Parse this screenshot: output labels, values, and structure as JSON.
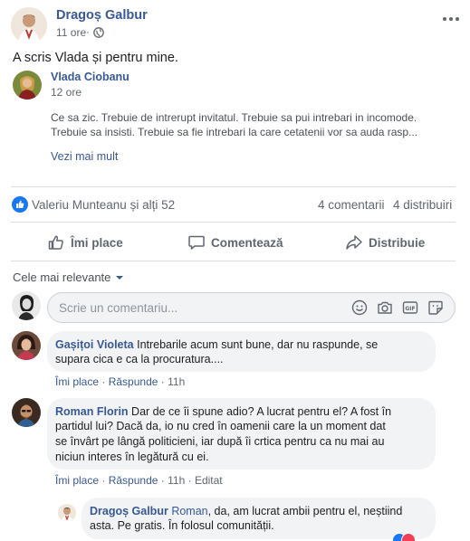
{
  "post": {
    "author": "Dragoș Galbur",
    "time": "11 ore",
    "privacy_icon": "globe-icon",
    "text": "A scris Vlada și pentru mine.",
    "menu_icon": "more-horizontal-icon"
  },
  "shared": {
    "author": "Vlada Ciobanu",
    "time": "12 ore",
    "text_line1": "Ce sa zic. Trebuie de intrerupt invitatul. Trebuie sa pui intrebari in incomode.",
    "text_line2": "Trebuie sa insisti. Trebuie sa fie intrebari la care cetatenii vor sa auda rasp...",
    "see_more": "Vezi mai mult"
  },
  "stats": {
    "reactions": "Valeriu Munteanu și alți 52",
    "comments": "4 comentarii",
    "shares": "4 distribuiri",
    "reaction_icon": "like-icon"
  },
  "actions": {
    "like": "Îmi place",
    "comment": "Comentează",
    "share": "Distribuie"
  },
  "sort": {
    "label": "Cele mai relevante"
  },
  "composer": {
    "placeholder": "Scrie un comentariu...",
    "icons": [
      "emoji-icon",
      "camera-icon",
      "gif-icon",
      "sticker-icon"
    ]
  },
  "comments": [
    {
      "author": "Gașițoi Violeta",
      "line1": "Intrebarile acum sunt bune, dar nu raspunde, se",
      "line2": "supara cica e ca la procuratura....",
      "like": "Îmi place",
      "reply": "Răspunde",
      "time": "11h"
    },
    {
      "author": "Roman Florin",
      "line1": "Dar de ce îi spune adio? A lucrat pentru el? A fost în",
      "line2": "partidul lui? Dacă da, io nu cred în oamenii care la un moment dat",
      "line3": "se învârt pe lângă politicieni, iar după îi crtica pentru ca nu mai au",
      "line4": "niciun interes în legătură cu ei.",
      "like": "Îmi place",
      "reply": "Răspunde",
      "time": "11h",
      "edited": "Editat"
    },
    {
      "author": "Dragoș Galbur",
      "mention": "Roman",
      "line1": ", da, am lucrat ambii pentru el, neștiind",
      "line2": "asta. Pe gratis. În folosul comunității."
    }
  ],
  "colors": {
    "link_blue": "#385898",
    "fb_blue": "#1877f2",
    "grey_text": "#606770",
    "bubble": "#f2f3f5",
    "divider": "#dadde1"
  }
}
